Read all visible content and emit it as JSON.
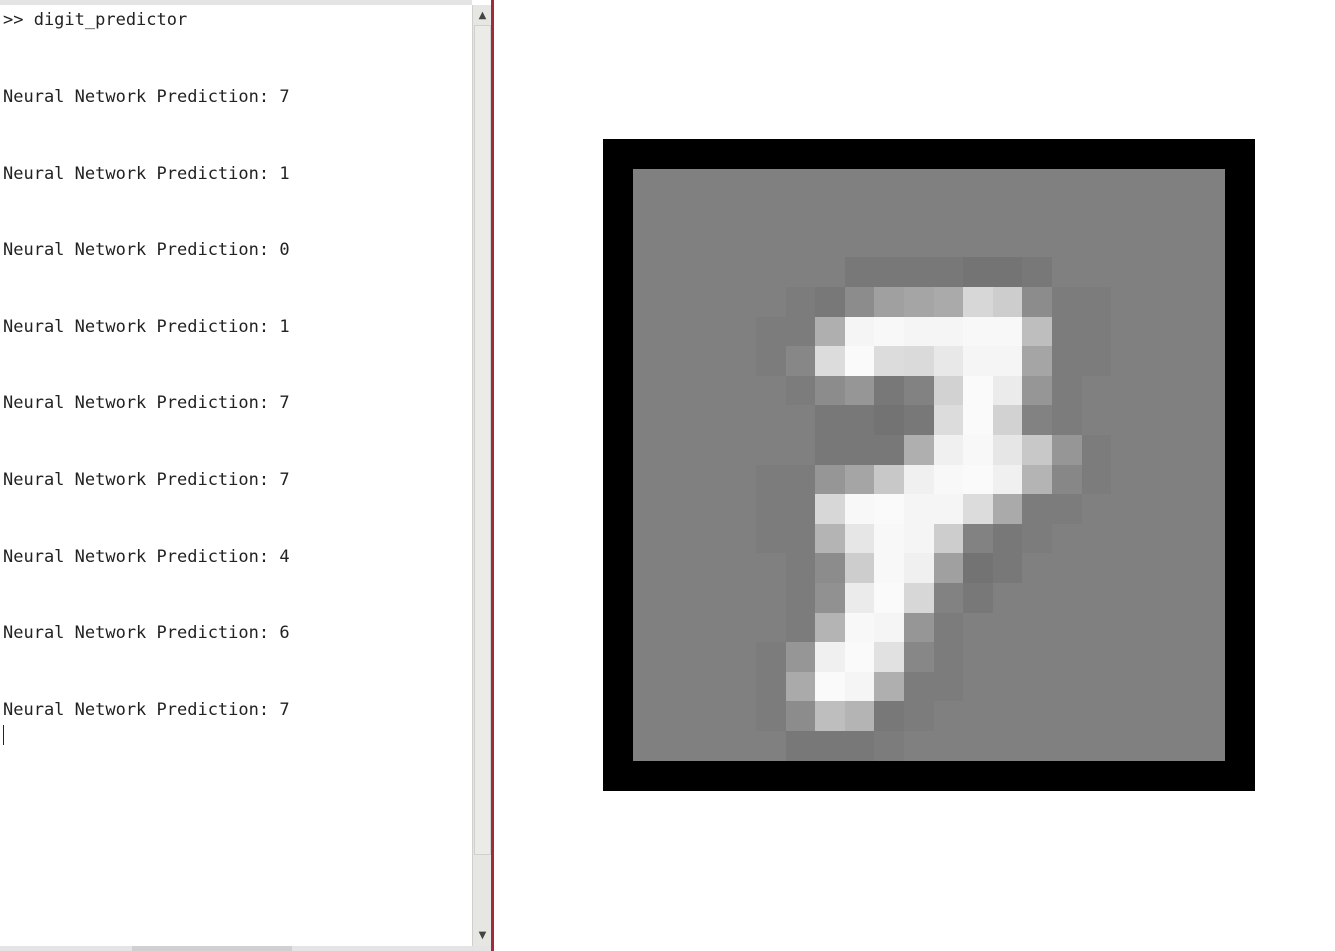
{
  "console": {
    "prompt_line": ">> digit_predictor",
    "output_lines": [
      "Neural Network Prediction: 7",
      "Neural Network Prediction: 1",
      "Neural Network Prediction: 0",
      "Neural Network Prediction: 1",
      "Neural Network Prediction: 7",
      "Neural Network Prediction: 7",
      "Neural Network Prediction: 4",
      "Neural Network Prediction: 6",
      "Neural Network Prediction: 7"
    ]
  },
  "scrollbar": {
    "up_icon": "scroll-up-arrow-icon",
    "down_icon": "scroll-down-arrow-icon"
  },
  "figure": {
    "image_grid_size": 20,
    "background_gray": 128,
    "pixels": [
      [
        0,
        8,
        120
      ],
      [
        0,
        9,
        120
      ],
      [
        0,
        10,
        120
      ],
      [
        0,
        11,
        120
      ],
      [
        0,
        12,
        116
      ],
      [
        0,
        13,
        116
      ],
      [
        0,
        14,
        120
      ],
      [
        1,
        6,
        124
      ],
      [
        1,
        7,
        120
      ],
      [
        1,
        8,
        140
      ],
      [
        1,
        9,
        160
      ],
      [
        1,
        10,
        165
      ],
      [
        1,
        11,
        170
      ],
      [
        1,
        12,
        215
      ],
      [
        1,
        13,
        205
      ],
      [
        1,
        14,
        140
      ],
      [
        1,
        15,
        124
      ],
      [
        1,
        16,
        124
      ],
      [
        2,
        5,
        124
      ],
      [
        2,
        6,
        124
      ],
      [
        2,
        7,
        175
      ],
      [
        2,
        8,
        245
      ],
      [
        2,
        9,
        248
      ],
      [
        2,
        10,
        245
      ],
      [
        2,
        11,
        245
      ],
      [
        2,
        12,
        248
      ],
      [
        2,
        13,
        248
      ],
      [
        2,
        14,
        190
      ],
      [
        2,
        15,
        124
      ],
      [
        2,
        16,
        124
      ],
      [
        3,
        5,
        124
      ],
      [
        3,
        6,
        135
      ],
      [
        3,
        7,
        220
      ],
      [
        3,
        8,
        250
      ],
      [
        3,
        9,
        220
      ],
      [
        3,
        10,
        218
      ],
      [
        3,
        11,
        232
      ],
      [
        3,
        12,
        245
      ],
      [
        3,
        13,
        245
      ],
      [
        3,
        14,
        165
      ],
      [
        3,
        15,
        124
      ],
      [
        3,
        16,
        124
      ],
      [
        4,
        6,
        124
      ],
      [
        4,
        7,
        140
      ],
      [
        4,
        8,
        150
      ],
      [
        4,
        9,
        120
      ],
      [
        4,
        10,
        130
      ],
      [
        4,
        11,
        210
      ],
      [
        4,
        12,
        250
      ],
      [
        4,
        13,
        235
      ],
      [
        4,
        14,
        150
      ],
      [
        4,
        15,
        124
      ],
      [
        5,
        7,
        120
      ],
      [
        5,
        8,
        120
      ],
      [
        5,
        9,
        115
      ],
      [
        5,
        10,
        120
      ],
      [
        5,
        11,
        220
      ],
      [
        5,
        12,
        250
      ],
      [
        5,
        13,
        210
      ],
      [
        5,
        14,
        130
      ],
      [
        5,
        15,
        124
      ],
      [
        6,
        7,
        120
      ],
      [
        6,
        8,
        120
      ],
      [
        6,
        9,
        120
      ],
      [
        6,
        10,
        175
      ],
      [
        6,
        11,
        240
      ],
      [
        6,
        12,
        248
      ],
      [
        6,
        13,
        230
      ],
      [
        6,
        14,
        200
      ],
      [
        6,
        15,
        150
      ],
      [
        6,
        16,
        124
      ],
      [
        7,
        5,
        124
      ],
      [
        7,
        6,
        124
      ],
      [
        7,
        7,
        150
      ],
      [
        7,
        8,
        165
      ],
      [
        7,
        9,
        200
      ],
      [
        7,
        10,
        240
      ],
      [
        7,
        11,
        248
      ],
      [
        7,
        12,
        250
      ],
      [
        7,
        13,
        240
      ],
      [
        7,
        14,
        180
      ],
      [
        7,
        15,
        135
      ],
      [
        7,
        16,
        124
      ],
      [
        8,
        5,
        124
      ],
      [
        8,
        6,
        124
      ],
      [
        8,
        7,
        215
      ],
      [
        8,
        8,
        248
      ],
      [
        8,
        9,
        250
      ],
      [
        8,
        10,
        245
      ],
      [
        8,
        11,
        245
      ],
      [
        8,
        12,
        220
      ],
      [
        8,
        13,
        170
      ],
      [
        8,
        14,
        124
      ],
      [
        8,
        15,
        124
      ],
      [
        9,
        5,
        124
      ],
      [
        9,
        6,
        124
      ],
      [
        9,
        7,
        180
      ],
      [
        9,
        8,
        230
      ],
      [
        9,
        9,
        248
      ],
      [
        9,
        10,
        245
      ],
      [
        9,
        11,
        205
      ],
      [
        9,
        12,
        130
      ],
      [
        9,
        13,
        120
      ],
      [
        9,
        14,
        124
      ],
      [
        10,
        6,
        124
      ],
      [
        10,
        7,
        140
      ],
      [
        10,
        8,
        205
      ],
      [
        10,
        9,
        248
      ],
      [
        10,
        10,
        240
      ],
      [
        10,
        11,
        160
      ],
      [
        10,
        12,
        115
      ],
      [
        10,
        13,
        120
      ],
      [
        11,
        6,
        124
      ],
      [
        11,
        7,
        145
      ],
      [
        11,
        8,
        235
      ],
      [
        11,
        9,
        250
      ],
      [
        11,
        10,
        215
      ],
      [
        11,
        11,
        130
      ],
      [
        11,
        12,
        120
      ],
      [
        12,
        6,
        124
      ],
      [
        12,
        7,
        180
      ],
      [
        12,
        8,
        248
      ],
      [
        12,
        9,
        245
      ],
      [
        12,
        10,
        150
      ],
      [
        12,
        11,
        124
      ],
      [
        13,
        5,
        124
      ],
      [
        13,
        6,
        150
      ],
      [
        13,
        7,
        240
      ],
      [
        13,
        8,
        250
      ],
      [
        13,
        9,
        225
      ],
      [
        13,
        10,
        135
      ],
      [
        13,
        11,
        124
      ],
      [
        14,
        5,
        124
      ],
      [
        14,
        6,
        170
      ],
      [
        14,
        7,
        250
      ],
      [
        14,
        8,
        245
      ],
      [
        14,
        9,
        175
      ],
      [
        14,
        10,
        124
      ],
      [
        14,
        11,
        124
      ],
      [
        15,
        5,
        124
      ],
      [
        15,
        6,
        140
      ],
      [
        15,
        7,
        190
      ],
      [
        15,
        8,
        180
      ],
      [
        15,
        9,
        120
      ],
      [
        15,
        10,
        124
      ],
      [
        16,
        6,
        120
      ],
      [
        16,
        7,
        120
      ],
      [
        16,
        8,
        120
      ],
      [
        16,
        9,
        124
      ]
    ]
  }
}
